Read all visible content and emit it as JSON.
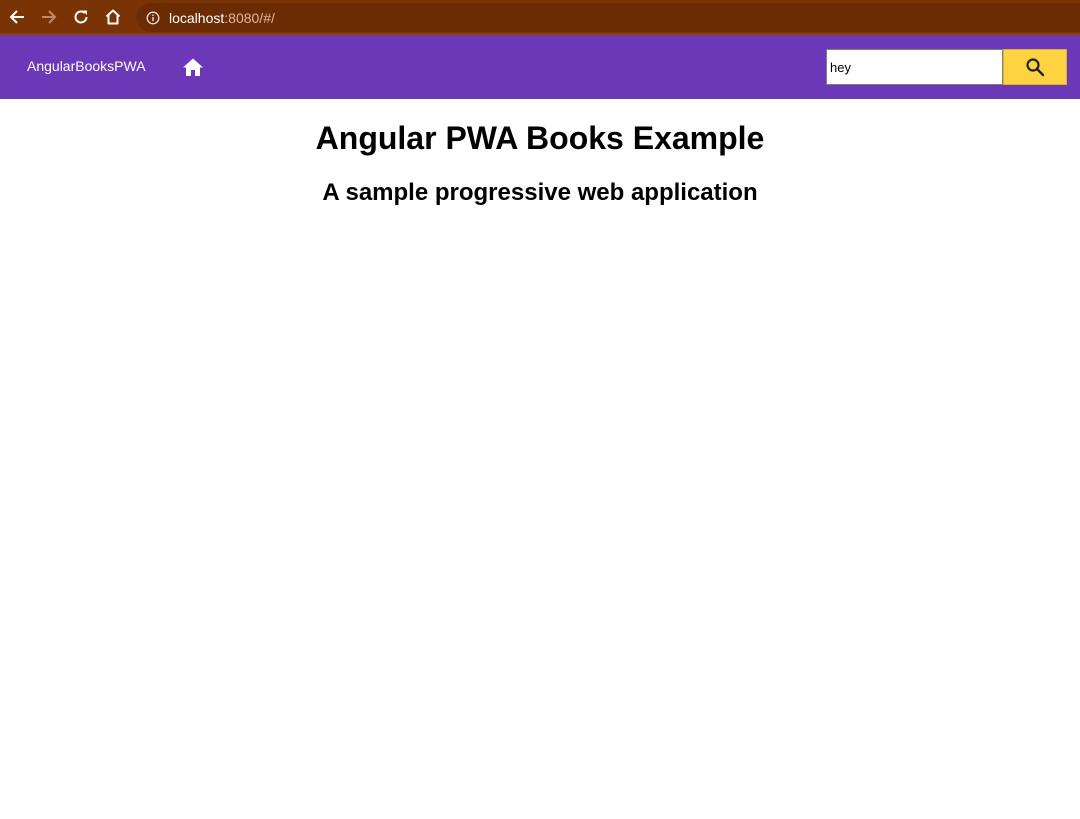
{
  "browser": {
    "url_host": "localhost",
    "url_path": ":8080/#/",
    "icons": {
      "back": "arrow-left-icon",
      "forward": "arrow-right-icon",
      "reload": "reload-icon",
      "home": "home-icon",
      "info": "info-icon"
    },
    "colors": {
      "bar": "#7a3305",
      "address": "#6b2c04"
    }
  },
  "toolbar": {
    "title": "AngularBooksPWA",
    "home_icon": "home-icon",
    "search": {
      "value": "hey",
      "button_icon": "search-icon"
    },
    "colors": {
      "background": "#6b38b8",
      "search_button": "#fdd33f"
    }
  },
  "main": {
    "title": "Angular PWA Books Example",
    "subtitle": "A sample progressive web application"
  }
}
